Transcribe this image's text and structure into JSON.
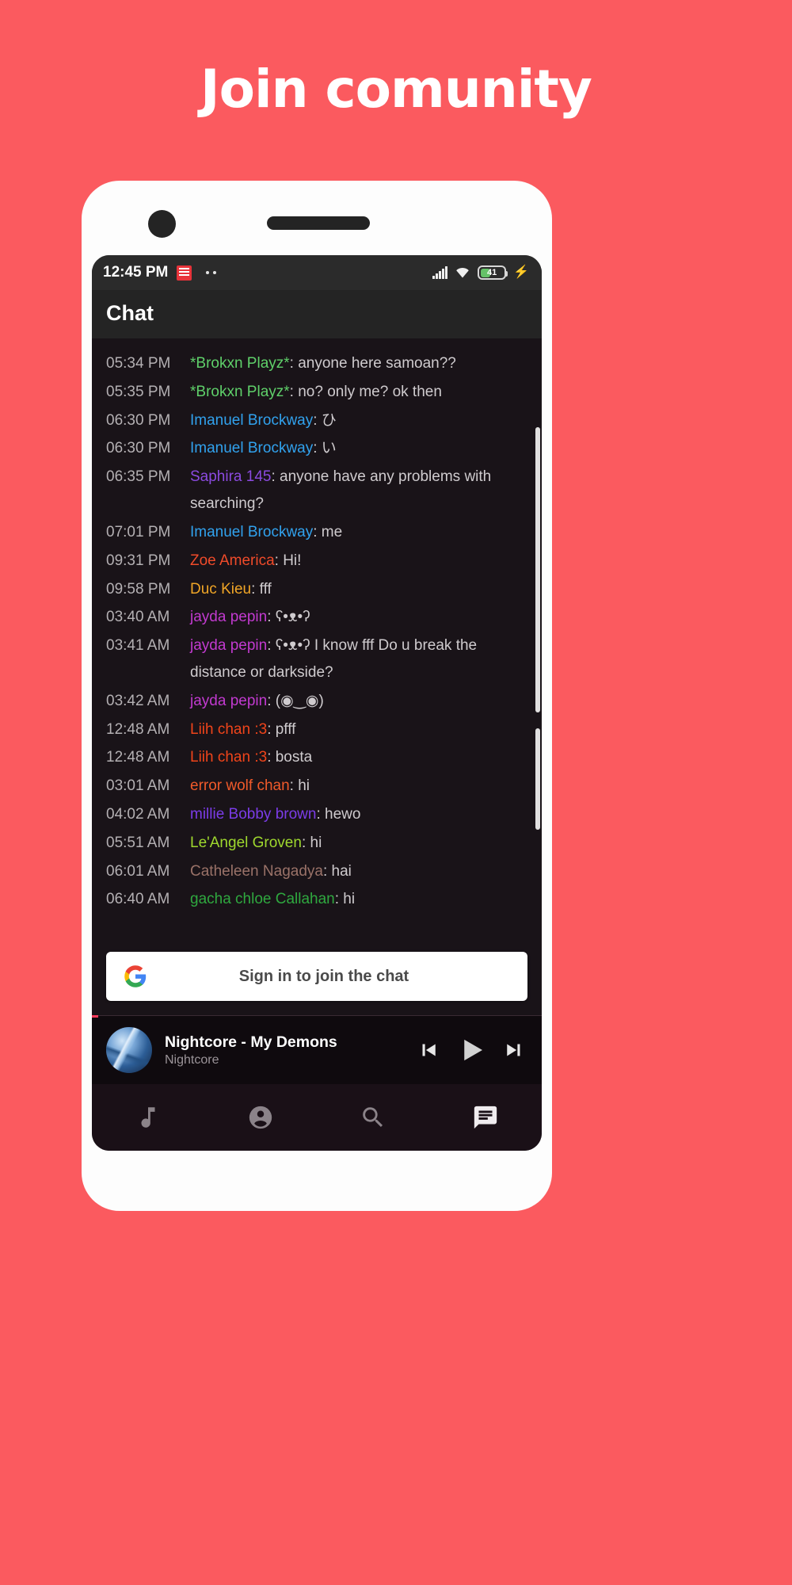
{
  "promo": {
    "title": "Join comunity",
    "bg_color": "#fb5a5f"
  },
  "status_bar": {
    "time": "12:45 PM",
    "app_icon": "notification-app-icon",
    "more_dots": "..",
    "signal_icon": "cellular-signal-icon",
    "wifi_icon": "wifi-icon",
    "battery_level": "41",
    "charging_icon": "charging-bolt-icon"
  },
  "header": {
    "title": "Chat"
  },
  "messages": [
    {
      "time": "05:34 PM",
      "user": "*Brokxn Playz*",
      "color": "#5fd06a",
      "body": ": anyone here samoan??"
    },
    {
      "time": "05:35 PM",
      "user": "*Brokxn Playz*",
      "color": "#5fd06a",
      "body": ": no? only me? ok then"
    },
    {
      "time": "06:30 PM",
      "user": "Imanuel Brockway",
      "color": "#31a2ee",
      "body": ": ひ"
    },
    {
      "time": "06:30 PM",
      "user": "Imanuel Brockway",
      "color": "#31a2ee",
      "body": ": い"
    },
    {
      "time": "06:35 PM",
      "user": "Saphira 145",
      "color": "#8b4ae0",
      "body": ": anyone have any problems with searching?"
    },
    {
      "time": "07:01 PM",
      "user": "Imanuel Brockway",
      "color": "#31a2ee",
      "body": ": me"
    },
    {
      "time": "09:31 PM",
      "user": "Zoe America",
      "color": "#f04b2a",
      "body": ": Hi!"
    },
    {
      "time": "09:58 PM",
      "user": "Duc Kieu",
      "color": "#f0a526",
      "body": ": fff"
    },
    {
      "time": "03:40 AM",
      "user": "jayda pepin",
      "color": "#c23ad0",
      "body": ": ʕ•ᴥ•ʔ"
    },
    {
      "time": "03:41 AM",
      "user": "jayda pepin",
      "color": "#c23ad0",
      "body": ": ʕ•ᴥ•ʔ I know fff Do u break the distance or darkside?"
    },
    {
      "time": "03:42 AM",
      "user": "jayda pepin",
      "color": "#c23ad0",
      "body": ": (◉‿◉)"
    },
    {
      "time": "12:48 AM",
      "user": "Liih chan :3",
      "color": "#f0441a",
      "body": ": pfff"
    },
    {
      "time": "12:48 AM",
      "user": "Liih chan :3",
      "color": "#f0441a",
      "body": ": bosta"
    },
    {
      "time": "03:01 AM",
      "user": "error wolf chan",
      "color": "#f05a2a",
      "body": ": hi"
    },
    {
      "time": "04:02 AM",
      "user": "millie Bobby brown",
      "color": "#7b3ce8",
      "body": ": hewo"
    },
    {
      "time": "05:51 AM",
      "user": "Le'Angel Groven",
      "color": "#9fd82e",
      "body": ": hi"
    },
    {
      "time": "06:01 AM",
      "user": "Catheleen Nagadya",
      "color": "#9a7268",
      "body": ": hai"
    },
    {
      "time": "06:40 AM",
      "user": "gacha chloe Callahan",
      "color": "#2fa83f",
      "body": ": hi"
    }
  ],
  "sign_in": {
    "label": "Sign in to join the chat",
    "provider_icon": "google-g-icon"
  },
  "player": {
    "title": "Nightcore - My Demons",
    "artist": "Nightcore",
    "album_art": "album-art-thumbnail",
    "previous_icon": "skip-previous-icon",
    "play_icon": "play-icon",
    "next_icon": "skip-next-icon"
  },
  "bottom_nav": [
    {
      "icon": "music-note-icon",
      "name": "nav-music"
    },
    {
      "icon": "account-circle-icon",
      "name": "nav-account"
    },
    {
      "icon": "search-icon",
      "name": "nav-search"
    },
    {
      "icon": "chat-bubble-icon",
      "name": "nav-chat",
      "active": true
    }
  ]
}
